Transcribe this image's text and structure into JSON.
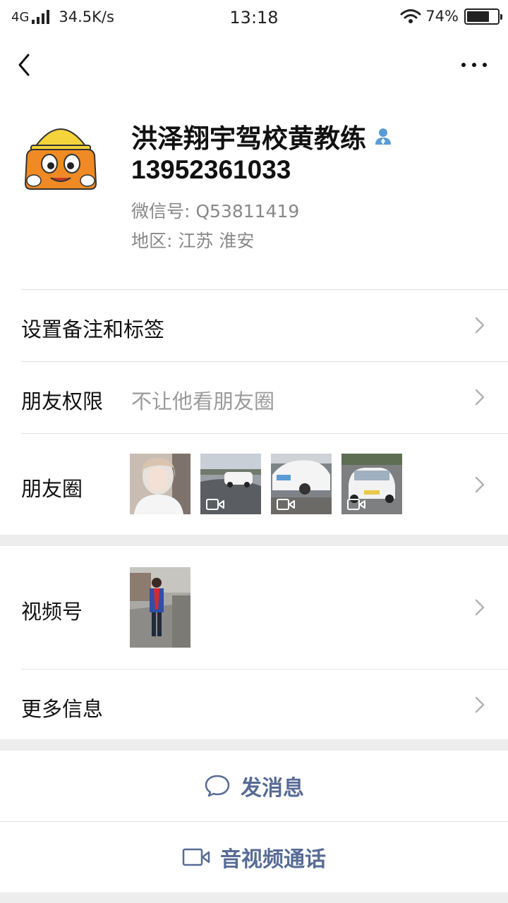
{
  "status_bar": {
    "network": "4G",
    "speed": "34.5K/s",
    "time": "13:18",
    "battery": "74%",
    "battery_level": 0.74
  },
  "icons": {
    "back": "chevron-left-icon",
    "more": "more-dots-icon",
    "badge": "contact-person-icon",
    "chevron": "chevron-right-icon",
    "video": "video-camera-icon",
    "message": "chat-bubble-icon"
  },
  "profile": {
    "name": "洪泽翔宇驾校黄教练",
    "phone": "13952361033",
    "wechat_id": "微信号:  Q53811419",
    "region": "地区:  江苏  淮安"
  },
  "rows": {
    "remark": {
      "label": "设置备注和标签"
    },
    "permission": {
      "label": "朋友权限",
      "value": "不让他看朋友圈"
    },
    "moments": {
      "label": "朋友圈"
    },
    "channels": {
      "label": "视频号"
    },
    "more_info": {
      "label": "更多信息"
    }
  },
  "actions": {
    "message": "发消息",
    "call": "音视频通话"
  },
  "colors": {
    "link": "#576b95",
    "secondary_text": "#888888",
    "background": "#ededed"
  }
}
